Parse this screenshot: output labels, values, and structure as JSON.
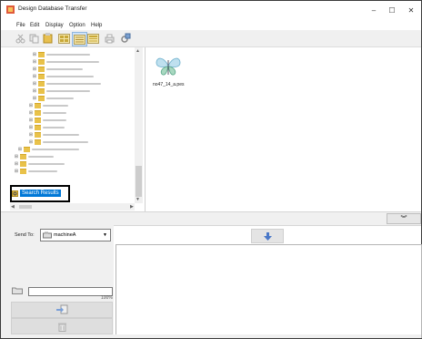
{
  "window": {
    "title": "Design Database Transfer",
    "minimize": "–",
    "maximize": "☐",
    "close": "✕"
  },
  "menu": [
    "File",
    "Edit",
    "Display",
    "Option",
    "Help"
  ],
  "tree": {
    "search_results": "Search Results"
  },
  "files": [
    {
      "name": "no47_14_a.pes"
    }
  ],
  "transfer": {
    "send_to_label": "Send To:",
    "machine": "machineA",
    "progress_percent": 100,
    "progress_label": "100%"
  },
  "colors": {
    "selection": "#0078d7",
    "folder": "#e9c24a",
    "arrow": "#4a78c8"
  },
  "icons": {
    "app": "app-icon",
    "cut": "scissors-icon",
    "copy": "copy-icon",
    "paste": "paste-icon",
    "view_large": "large-icons-view",
    "view_list": "list-view-icon",
    "view_details": "details-view-icon",
    "print": "print-icon",
    "settings": "settings-icon",
    "file": "butterfly-icon",
    "down_arrow": "down-arrow-icon",
    "collapse": "double-chevron-down-icon",
    "transfer": "transfer-icon",
    "delete": "trash-icon"
  }
}
